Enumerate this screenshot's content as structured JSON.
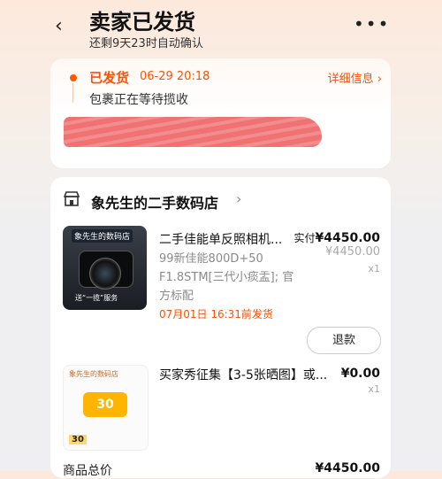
{
  "header": {
    "back_icon": "chevron-left-icon",
    "title": "卖家已发货",
    "subtitle": "还剩9天23时自动确认",
    "more_icon": "more-dots-icon"
  },
  "status": {
    "label": "已发货",
    "time": "06-29 20:18",
    "detail_link": "详细信息 ›",
    "description": "包裹正在等待揽收"
  },
  "shop": {
    "icon": "store-icon",
    "name": "象先生的二手数码店",
    "chevron": "›"
  },
  "items": [
    {
      "title": "二手佳能单反照相机...",
      "spec": "99新佳能800D+50 F1.8STM[三代小痰盂]; 官方标配",
      "ship_time": "07月01日 16:31前发货",
      "paid_label": "实付",
      "paid_amount": "¥4450.00",
      "original_price": "¥4450.00",
      "quantity": "x1",
      "refund_button": "退款",
      "thumb_banner": "象先生的数码店",
      "thumb_tag": "送“一揽”服务"
    },
    {
      "title": "买家秀征集【3-5张晒图】或...",
      "price": "¥0.00",
      "quantity": "x1",
      "thumb_top": "象先生的数码店",
      "thumb_badge": "30",
      "thumb_bottom": "30"
    }
  ],
  "summary": {
    "total_label": "商品总价",
    "total_value": "¥4450.00"
  },
  "colors": {
    "accent": "#ff5000",
    "redaction": "#f06a6a"
  }
}
